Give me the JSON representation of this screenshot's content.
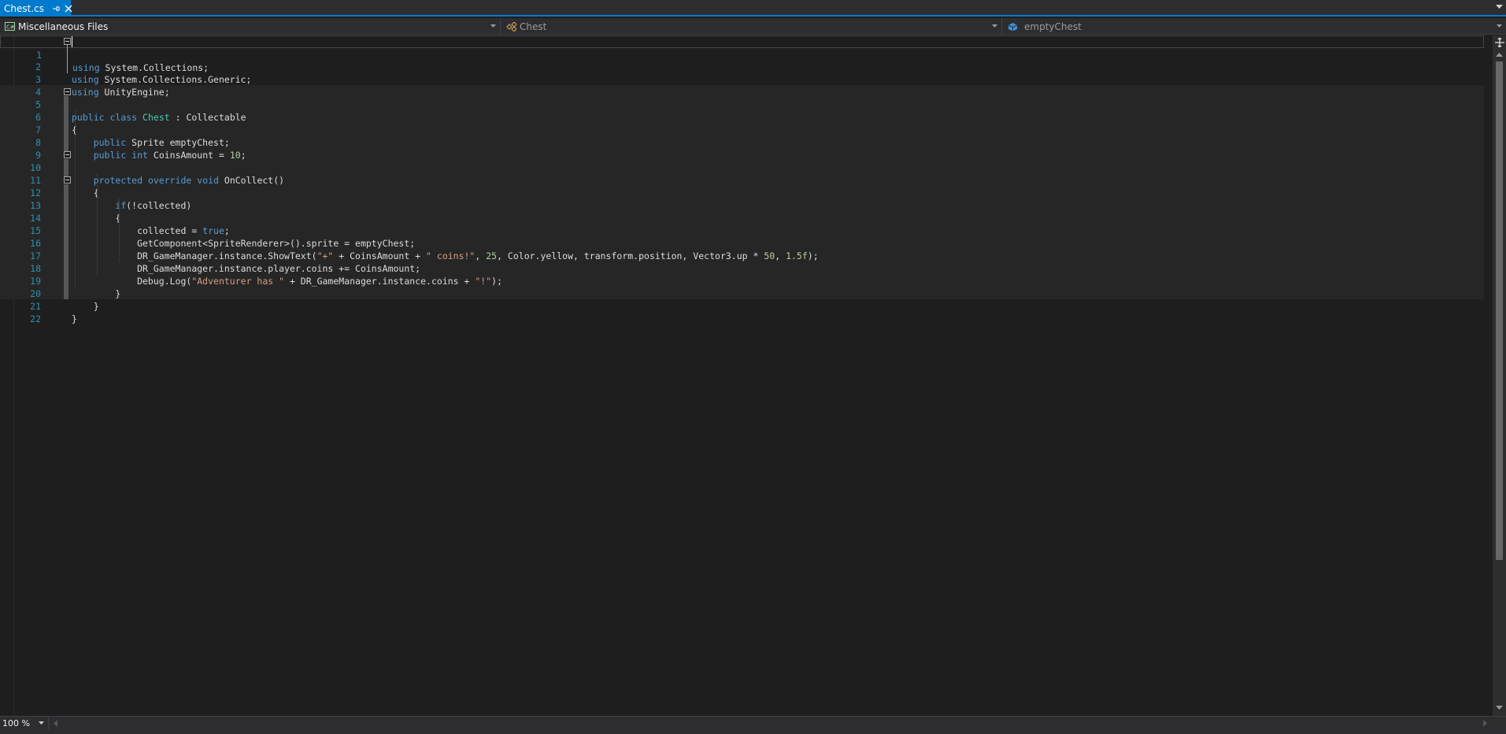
{
  "tabs": [
    {
      "label": "Chest.cs",
      "active": true
    }
  ],
  "nav": {
    "project": "Miscellaneous Files",
    "type": "Chest",
    "member": "emptyChest"
  },
  "editor": {
    "line_numbers": [
      "1",
      "2",
      "3",
      "4",
      "5",
      "6",
      "7",
      "8",
      "9",
      "10",
      "11",
      "12",
      "13",
      "14",
      "15",
      "16",
      "17",
      "18",
      "19",
      "20",
      "21",
      "22"
    ],
    "lines": [
      "using System.Collections;",
      "using System.Collections.Generic;",
      "using UnityEngine;",
      "",
      "public class Chest : Collectable",
      "{",
      "    public Sprite emptyChest;",
      "    public int CoinsAmount = 10;",
      "",
      "    protected override void OnCollect()",
      "    {",
      "        if(!collected)",
      "        {",
      "            collected = true;",
      "            GetComponent<SpriteRenderer>().sprite = emptyChest;",
      "            DR_GameManager.instance.ShowText(\"+\" + CoinsAmount + \" coins!\", 25, Color.yellow, transform.position, Vector3.up * 50, 1.5f);",
      "            DR_GameManager.instance.player.coins += CoinsAmount;",
      "            Debug.Log(\"Adventurer has \" + DR_GameManager.instance.coins + \"!\");",
      "        }",
      "    }",
      "}",
      ""
    ]
  },
  "status": {
    "zoom": "100 %"
  },
  "colors": {
    "accent": "#007acc",
    "keyword": "#569cd6",
    "type": "#4ec9b0",
    "string": "#d69d85",
    "number": "#b5cea8",
    "line_number": "#2b91af"
  },
  "icons": [
    "pin-icon",
    "close-icon",
    "tab-overflow-icon",
    "csharp-project-icon",
    "class-icon",
    "field-icon",
    "chevron-down-icon",
    "split-icon",
    "scroll-up-icon",
    "scroll-down-icon",
    "scroll-left-icon",
    "scroll-right-icon"
  ]
}
